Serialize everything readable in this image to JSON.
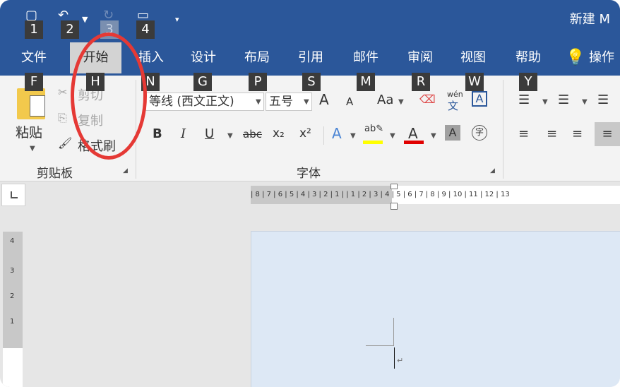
{
  "titlebar": {
    "doc_title": "新建 M",
    "qat_keytips": [
      "1",
      "2",
      "3",
      "4"
    ]
  },
  "tabs": [
    {
      "label": "文件",
      "keytip": "F"
    },
    {
      "label": "开始",
      "keytip": "H",
      "active": true
    },
    {
      "label": "插入",
      "keytip": "N"
    },
    {
      "label": "设计",
      "keytip": "G"
    },
    {
      "label": "布局",
      "keytip": "P"
    },
    {
      "label": "引用",
      "keytip": "S"
    },
    {
      "label": "邮件",
      "keytip": "M"
    },
    {
      "label": "审阅",
      "keytip": "R"
    },
    {
      "label": "视图",
      "keytip": "W"
    },
    {
      "label": "帮助",
      "keytip": "Y"
    },
    {
      "label": "操作"
    }
  ],
  "clipboard": {
    "paste_label": "粘贴",
    "cut_label": "剪切",
    "copy_label": "复制",
    "format_painter_label": "格式刷",
    "group_label": "剪贴板"
  },
  "font": {
    "font_name": "等线 (西文正文)",
    "font_size": "五号",
    "group_label": "字体",
    "change_case_label": "Aa",
    "bold": "B",
    "italic": "I",
    "underline": "U",
    "strikethrough": "abc",
    "subscript": "x₂",
    "superscript": "x²",
    "grow": "A",
    "shrink": "A",
    "phonetic_top": "wén",
    "phonetic_bottom": "文",
    "enclose": "字"
  },
  "ruler": {
    "h_ticks": "| 8 | 7 | 6 | 5 | 4 | 3 | 2 | 1 |   | 1 | 2 | 3 | 4 | 5 | 6 | 7 | 8 | 9 | 10 | 11 | 12 | 13",
    "v_ticks": [
      "4",
      "3",
      "2",
      "1"
    ]
  },
  "colors": {
    "title_bar": "#2b579a",
    "active_tab": "#d3d3d3",
    "highlight_annotation": "#e53935",
    "font_color_bar": "#e00000",
    "highlight_color_bar": "#ffff00"
  }
}
